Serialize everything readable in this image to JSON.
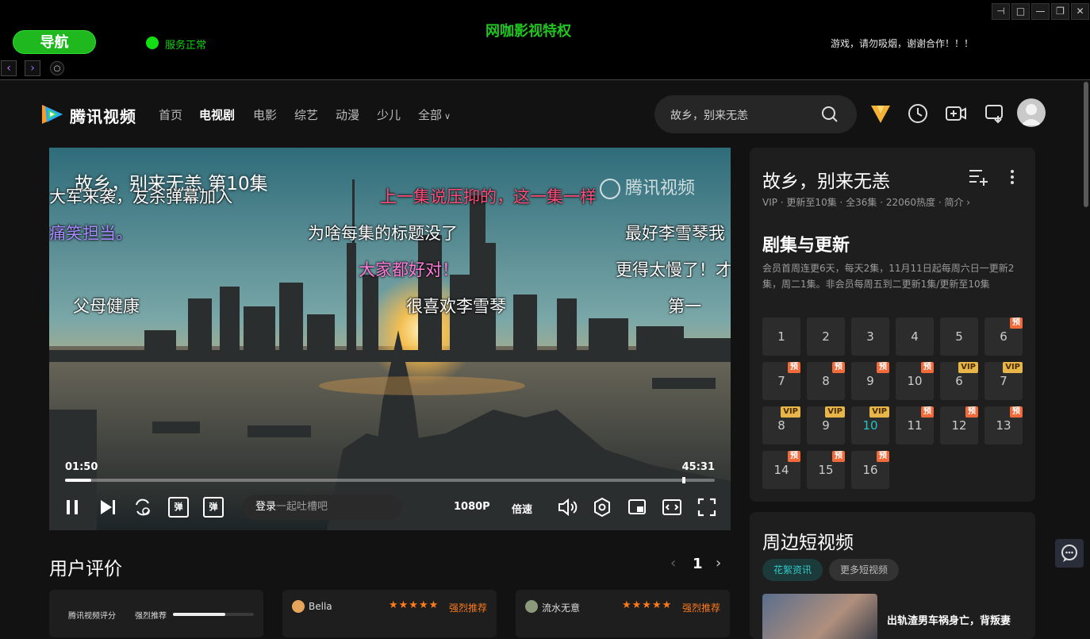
{
  "shell": {
    "nav_label": "导航",
    "status": "服务正常",
    "title": "网咖影视特权",
    "notice": "游戏，请勿吸烟，谢谢合作！！！"
  },
  "header": {
    "logo_text": "腾讯视频",
    "nav": [
      "首页",
      "电视剧",
      "电影",
      "综艺",
      "动漫",
      "少儿",
      "全部"
    ],
    "active_nav": "电视剧",
    "search_placeholder": "故乡，别来无恙"
  },
  "player": {
    "episode_title": "故乡，别来无恙 第10集",
    "watermark": "腾讯视频",
    "time_current": "01:50",
    "time_total": "45:31",
    "progress_fraction": 0.04,
    "buffer_fraction": 0.95,
    "danmu_login": "登录",
    "danmu_placeholder": "一起吐槽吧",
    "quality": "1080P",
    "speed": "倍速",
    "danmu_btn": "弹",
    "danmaku": [
      {
        "text": "大军来袭，友杀弹幕加入",
        "color": "#ffffff"
      },
      {
        "text": "上一集说压抑的，这一集一样",
        "color": "#ff4d7a"
      },
      {
        "text": "痛笑担当。",
        "color": "#a98cff"
      },
      {
        "text": "为啥每集的标题没了",
        "color": "#ffffff"
      },
      {
        "text": "最好李雪琴我",
        "color": "#ffffff"
      },
      {
        "text": "大家都好对！",
        "color": "#ff7ad9"
      },
      {
        "text": "更得太慢了！才",
        "color": "#ffffff"
      },
      {
        "text": "父母健康",
        "color": "#ffffff"
      },
      {
        "text": "很喜欢李雪琴",
        "color": "#ffffff"
      },
      {
        "text": "第一",
        "color": "#ffffff"
      }
    ]
  },
  "side": {
    "show_title": "故乡，别来无恙",
    "meta": "VIP · 更新至10集 · 全36集 · 22060热度 · 简介 ›",
    "section_title": "剧集与更新",
    "description": "会员首周连更6天，每天2集，11月11日起每周六日一更新2集，周二1集。非会员每周五到二更新1集/更新至10集",
    "badge_pre": "预",
    "badge_vip": "VIP",
    "episodes": [
      {
        "num": "1",
        "badge": ""
      },
      {
        "num": "2",
        "badge": ""
      },
      {
        "num": "3",
        "badge": ""
      },
      {
        "num": "4",
        "badge": ""
      },
      {
        "num": "5",
        "badge": ""
      },
      {
        "num": "6",
        "badge": "pre"
      },
      {
        "num": "7",
        "badge": "pre"
      },
      {
        "num": "8",
        "badge": "pre"
      },
      {
        "num": "9",
        "badge": "pre"
      },
      {
        "num": "10",
        "badge": "pre"
      },
      {
        "num": "6",
        "badge": "vip"
      },
      {
        "num": "7",
        "badge": "vip"
      },
      {
        "num": "8",
        "badge": "vip"
      },
      {
        "num": "9",
        "badge": "vip"
      },
      {
        "num": "10",
        "badge": "vip",
        "current": true
      },
      {
        "num": "11",
        "badge": "pre"
      },
      {
        "num": "12",
        "badge": "pre"
      },
      {
        "num": "13",
        "badge": "pre"
      },
      {
        "num": "14",
        "badge": "pre"
      },
      {
        "num": "15",
        "badge": "pre"
      },
      {
        "num": "16",
        "badge": "pre"
      }
    ]
  },
  "shorts": {
    "title": "周边短视频",
    "chips": [
      "花絮资讯",
      "更多短视频"
    ],
    "caption": "出轨渣男车祸身亡，背叛妻"
  },
  "reviews": {
    "heading": "用户评价",
    "page": "1",
    "prev": "‹",
    "next": "›",
    "score_label": "腾讯视频评分",
    "strong_label": "强烈推荐",
    "strong_fraction": 0.65,
    "cards": [
      {
        "name": "Bella",
        "stars": "★★★★★",
        "tag": "强烈推荐"
      },
      {
        "name": "流水无意",
        "stars": "★★★★★",
        "tag": "强烈推荐"
      }
    ]
  }
}
